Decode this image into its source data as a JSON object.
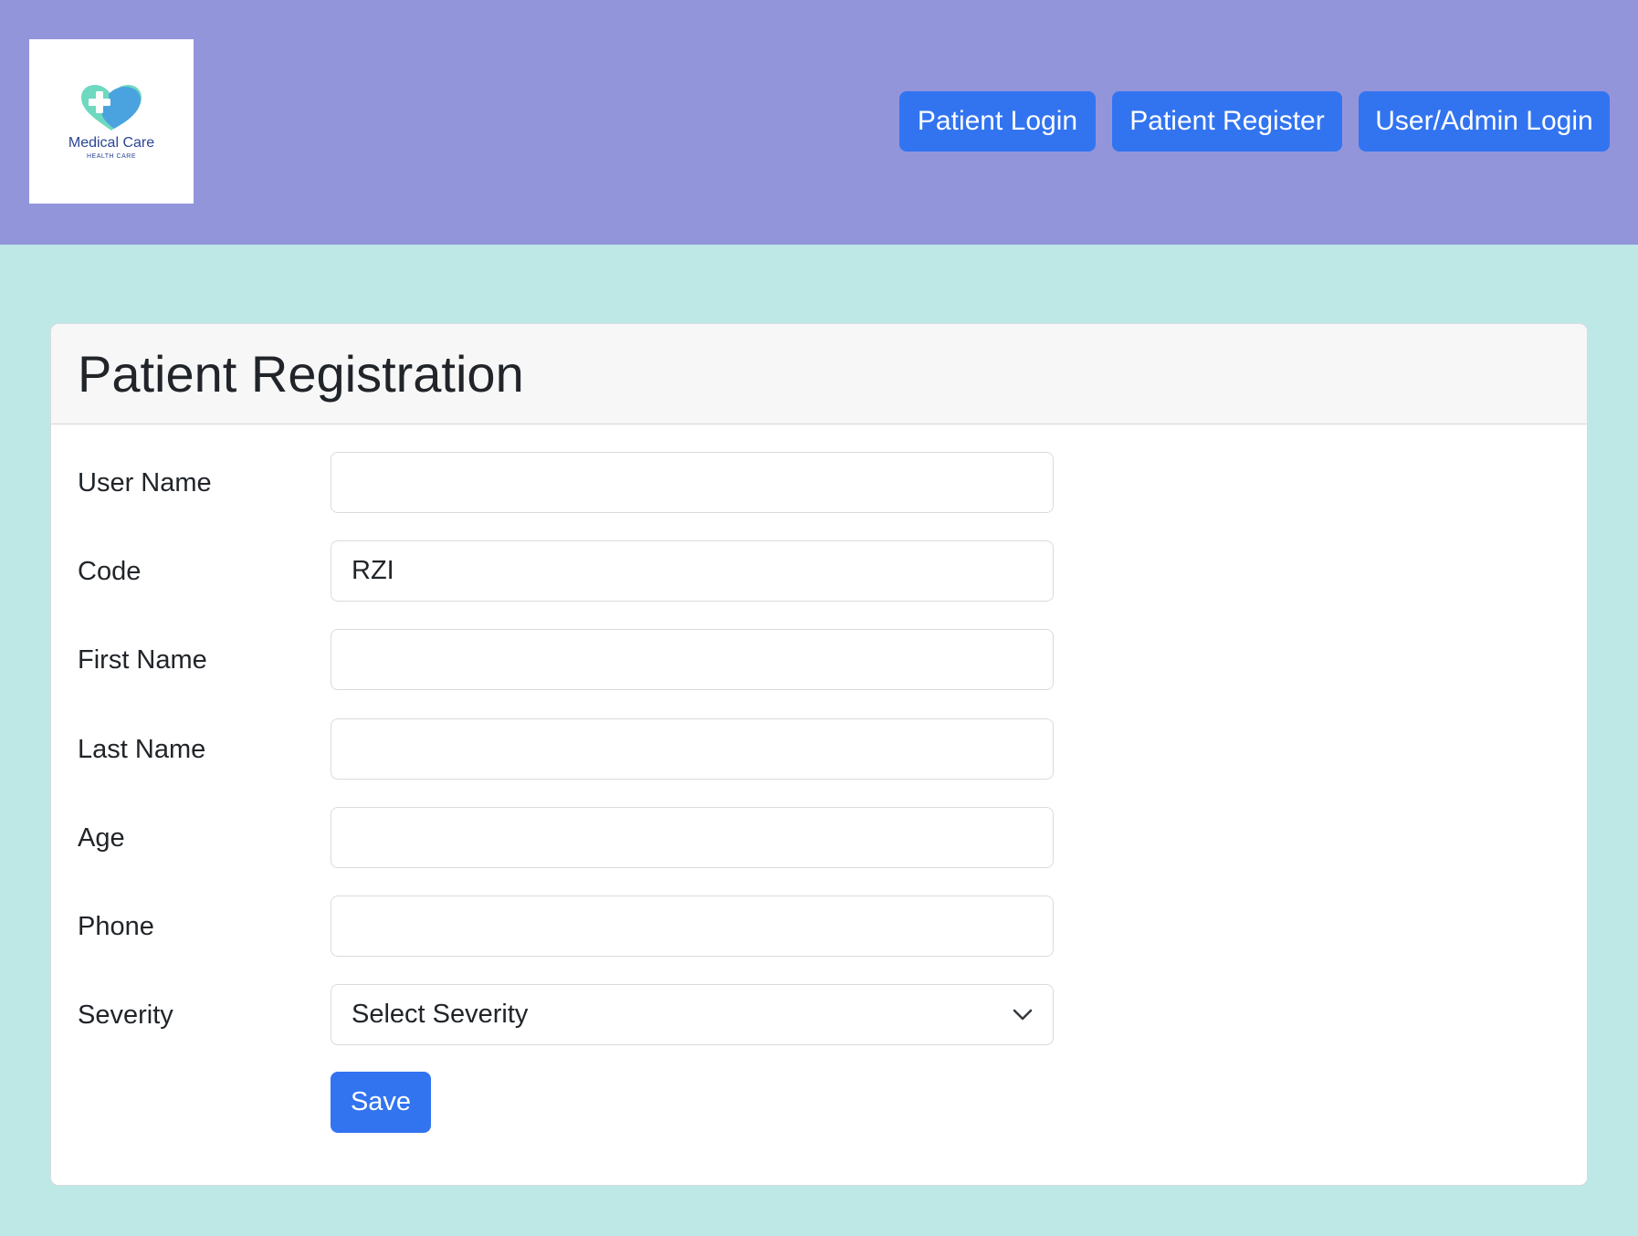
{
  "logo": {
    "title": "Medical Care",
    "subtitle": "HEALTH CARE",
    "icon": "heart-cross-icon"
  },
  "nav": {
    "patient_login": "Patient Login",
    "patient_register": "Patient Register",
    "admin_login": "User/Admin Login"
  },
  "form": {
    "title": "Patient Registration",
    "fields": {
      "user_name": {
        "label": "User Name",
        "value": ""
      },
      "code": {
        "label": "Code",
        "value": "RZI"
      },
      "first_name": {
        "label": "First Name",
        "value": ""
      },
      "last_name": {
        "label": "Last Name",
        "value": ""
      },
      "age": {
        "label": "Age",
        "value": ""
      },
      "phone": {
        "label": "Phone",
        "value": ""
      }
    },
    "severity": {
      "label": "Severity",
      "selected": "Select Severity",
      "icon": "chevron-down-icon"
    },
    "save_label": "Save"
  },
  "colors": {
    "navbar_bg": "#9395db",
    "page_bg": "#bde8e6",
    "primary_button": "#3274f0",
    "logo_text": "#2a4594",
    "heart_green": "#6fd9c0",
    "heart_blue": "#4aa3df"
  }
}
